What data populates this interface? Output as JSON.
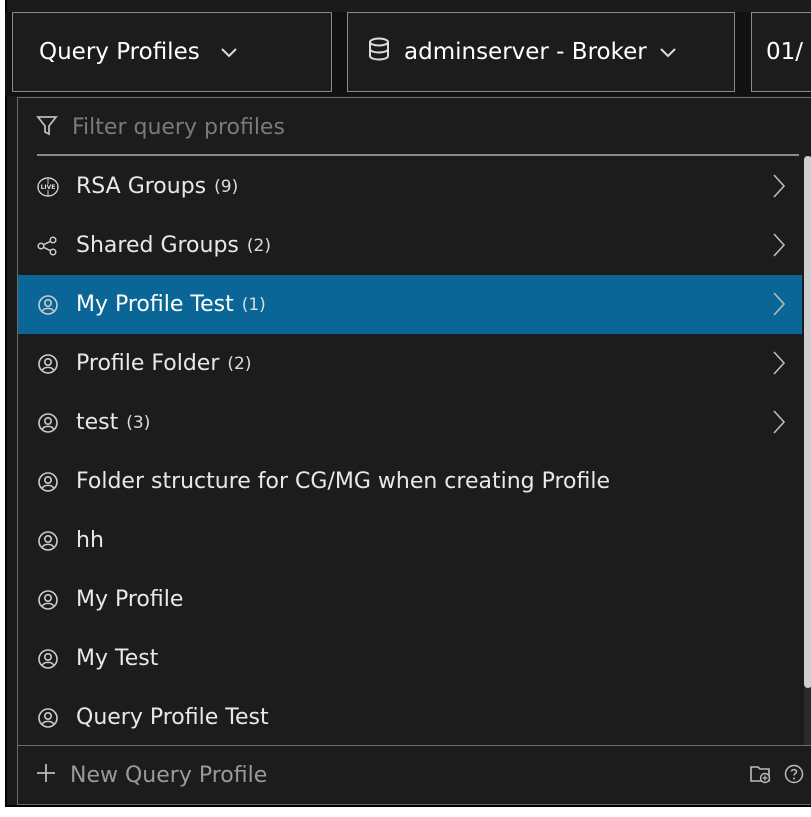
{
  "header": {
    "profiles_label": "Query Profiles",
    "server_label": "adminserver - Broker",
    "date_label": "01/"
  },
  "filter": {
    "placeholder": "Filter query profiles"
  },
  "items": [
    {
      "label": "RSA Groups",
      "count": "(9)",
      "icon": "live-icon",
      "has_arrow": true
    },
    {
      "label": "Shared Groups",
      "count": "(2)",
      "icon": "share-icon",
      "has_arrow": true
    },
    {
      "label": "My Profile Test",
      "count": "(1)",
      "icon": "user-icon",
      "has_arrow": true,
      "selected": true
    },
    {
      "label": "Profile Folder",
      "count": "(2)",
      "icon": "user-icon",
      "has_arrow": true
    },
    {
      "label": "test",
      "count": "(3)",
      "icon": "user-icon",
      "has_arrow": true
    },
    {
      "label": "Folder structure for CG/MG when creating Profile",
      "count": "",
      "icon": "user-icon"
    },
    {
      "label": "hh",
      "count": "",
      "icon": "user-icon"
    },
    {
      "label": "My Profile",
      "count": "",
      "icon": "user-icon"
    },
    {
      "label": "My Test",
      "count": "",
      "icon": "user-icon"
    },
    {
      "label": "Query Profile Test",
      "count": "",
      "icon": "user-icon"
    }
  ],
  "footer": {
    "new_label": "New Query Profile"
  },
  "colors": {
    "selected": "#0a6696",
    "panel": "#1c1c1c"
  }
}
